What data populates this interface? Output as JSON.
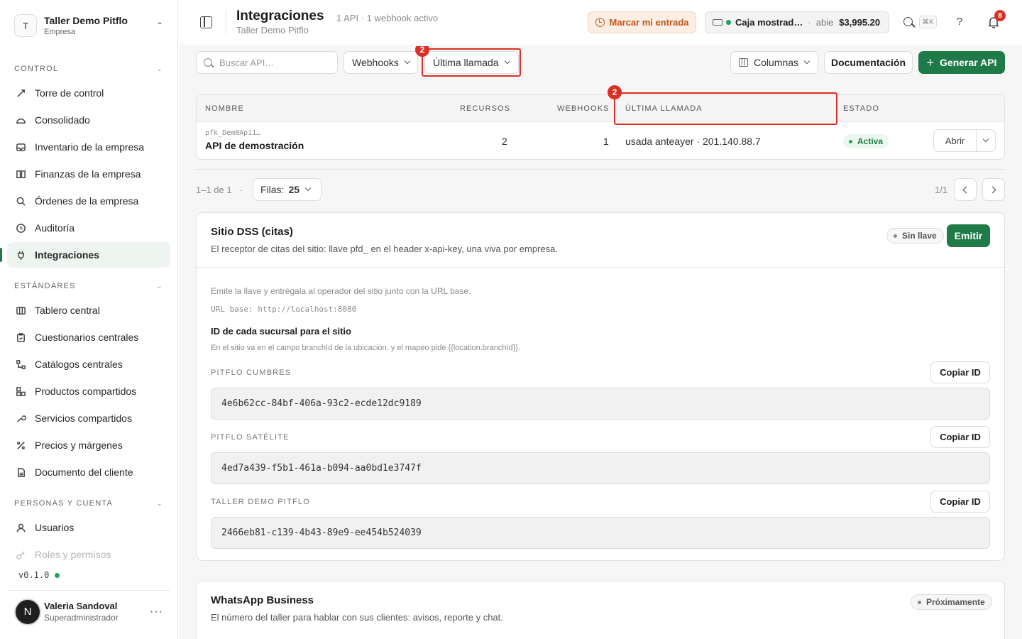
{
  "org": {
    "initial": "T",
    "name": "Taller Demo Pitflo",
    "type": "Empresa"
  },
  "sidebar": {
    "sections": [
      {
        "title": "CONTROL",
        "items": [
          {
            "label": "Torre de control",
            "icon": "gauge-icon"
          },
          {
            "label": "Consolidado",
            "icon": "cloud-icon"
          },
          {
            "label": "Inventario de la empresa",
            "icon": "inbox-icon"
          },
          {
            "label": "Finanzas de la empresa",
            "icon": "book-icon"
          },
          {
            "label": "Órdenes de la empresa",
            "icon": "search-icon"
          },
          {
            "label": "Auditoría",
            "icon": "history-icon"
          },
          {
            "label": "Integraciones",
            "icon": "plug-icon",
            "active": true
          }
        ]
      },
      {
        "title": "ESTÁNDARES",
        "items": [
          {
            "label": "Tablero central",
            "icon": "columns-icon"
          },
          {
            "label": "Cuestionarios centrales",
            "icon": "clipboard-icon"
          },
          {
            "label": "Catálogos centrales",
            "icon": "tree-icon"
          },
          {
            "label": "Productos compartidos",
            "icon": "boxes-icon"
          },
          {
            "label": "Servicios compartidos",
            "icon": "wrench-icon"
          },
          {
            "label": "Precios y márgenes",
            "icon": "percent-icon"
          },
          {
            "label": "Documento del cliente",
            "icon": "document-icon"
          }
        ]
      },
      {
        "title": "PERSONAS Y CUENTA",
        "items": [
          {
            "label": "Usuarios",
            "icon": "user-icon"
          },
          {
            "label": "Roles y permisos",
            "icon": "key-icon"
          }
        ]
      }
    ],
    "version": "v0.1.0"
  },
  "user": {
    "initial": "N",
    "name": "Valeria Sandoval",
    "role": "Superadministrador",
    "more": "···"
  },
  "header": {
    "title": "Integraciones",
    "meta": "1 API · 1 webhook activo",
    "subtitle": "Taller Demo Pitflo",
    "checkin_label": "Marcar mi entrada",
    "register": {
      "name": "Caja mostrad…",
      "sep": "·",
      "status": "abie",
      "amount": "$3,995.20"
    },
    "shortcut": "⌘K",
    "help": "?",
    "notifications": "8"
  },
  "toolbar": {
    "search_placeholder": "Buscar API…",
    "filter_webhooks": "Webhooks",
    "filter_last_call": "Última llamada",
    "columns_label": "Columnas",
    "docs_label": "Documentación",
    "generate_label": "Generar API",
    "generate_plus": "+"
  },
  "annotations": {
    "badge": "2"
  },
  "table": {
    "headers": {
      "name": "NOMBRE",
      "resources": "RECURSOS",
      "webhooks": "WEBHOOKS",
      "last_call": "ÚLTIMA LLAMADA",
      "status": "ESTADO"
    },
    "rows": [
      {
        "key": "pfk_Dem0Api1…",
        "name": "API de demostración",
        "resources": "2",
        "webhooks": "1",
        "last_call": "usada anteayer · 201.140.88.7",
        "status": "Activa",
        "open": "Abrir"
      }
    ]
  },
  "pagination": {
    "info": "1–1 de 1",
    "sep": "·",
    "rows_label": "Filas:",
    "rows_value": "25",
    "page": "1/1"
  },
  "dss": {
    "title": "Sitio DSS (citas)",
    "description": "El receptor de citas del sitio: llave pfd_ en el header x-api-key, una viva por empresa.",
    "badge": "Sin llave",
    "emit_label": "Emitir",
    "note": "Emite la llave y entrégala al operador del sitio junto con la URL base.",
    "base_url": "URL base: http://localhost:8080",
    "branches_title": "ID de cada sucursal para el sitio",
    "branches_note": "En el sitio va en el campo branchId de la ubicación, y el mapeo pide {{location.branchId}}.",
    "copy_label": "Copiar ID",
    "branches": [
      {
        "name": "PITFLO CUMBRES",
        "id": "4e6b62cc-84bf-406a-93c2-ecde12dc9189"
      },
      {
        "name": "PITFLO SATÉLITE",
        "id": "4ed7a439-f5b1-461a-b094-aa0bd1e3747f"
      },
      {
        "name": "TALLER DEMO PITFLO",
        "id": "2466eb81-c139-4b43-89e9-ee454b524039"
      }
    ]
  },
  "whatsapp": {
    "title": "WhatsApp Business",
    "description": "El número del taller para hablar con sus clientes: avisos, reporte y chat.",
    "badge": "Próximamente"
  },
  "colors": {
    "accent": "#1e7a46",
    "highlight": "#d93025",
    "checkin": "#c2571b"
  }
}
